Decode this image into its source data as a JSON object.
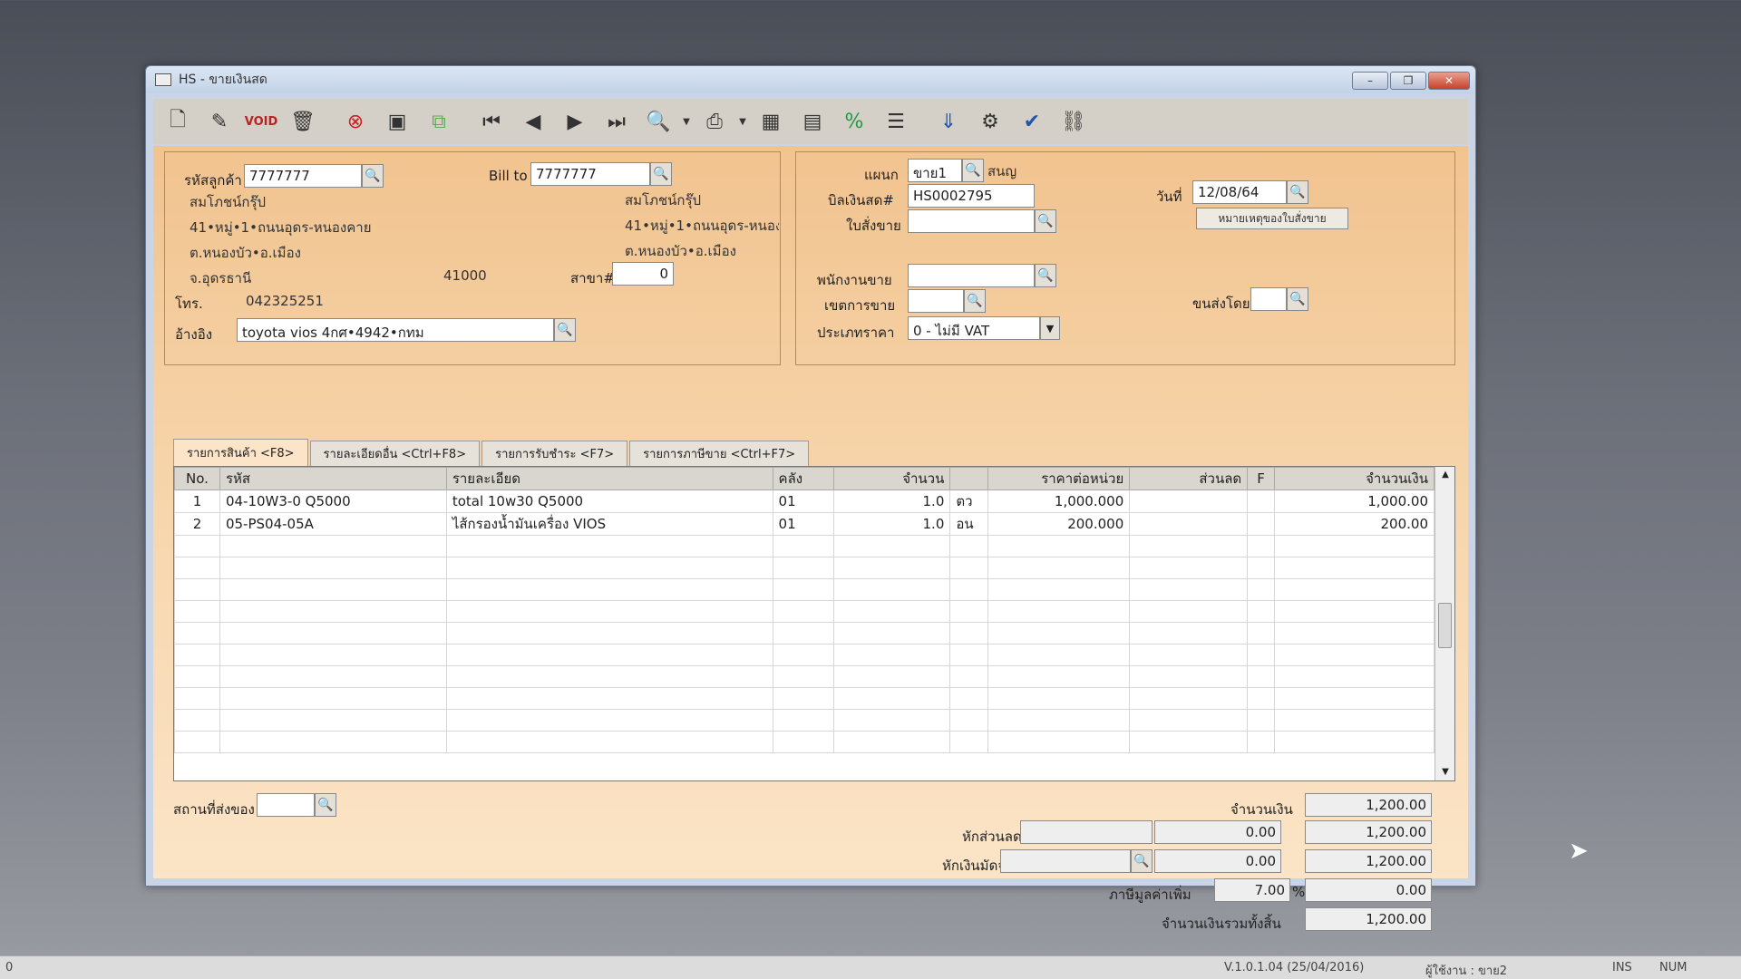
{
  "window": {
    "title": "HS - ขายเงินสด",
    "controls": [
      "–",
      "❐",
      "✕"
    ]
  },
  "toolbar": {
    "icons": [
      "new-doc-icon",
      "edit-icon",
      "void-icon",
      "delete-icon",
      "cancel-icon",
      "save-icon",
      "copy-icon",
      "first-icon",
      "prev-icon",
      "next-icon",
      "last-icon",
      "preview-icon",
      "print-icon",
      "calc-icon",
      "form-icon",
      "percent-icon",
      "report-icon",
      "approve-icon",
      "tools-icon",
      "ok-icon",
      "network-icon"
    ]
  },
  "customer": {
    "code_label": "รหัสลูกค้า",
    "code": "7777777",
    "name": "สมโภชน์กรุ๊ป",
    "address1": "41•หมู่•1•ถนนอุดร-หนองคาย",
    "address2": "ต.หนองบัว•อ.เมือง",
    "province": "จ.อุดรธานี",
    "postcode": "41000",
    "phone_label": "โทร.",
    "phone": "042325251",
    "ref_label": "อ้างอิง",
    "ref": "toyota vios 4กศ•4942•กทม"
  },
  "billto": {
    "label": "Bill to",
    "code": "7777777",
    "name": "สมโภชน์กรุ๊ป",
    "address1": "41•หมู่•1•ถนนอุดร-หนอง",
    "address2": "ต.หนองบัว•อ.เมือง",
    "branch_label": "สาขา#",
    "branch": "0"
  },
  "doc": {
    "dept_label": "แผนก",
    "dept": "ขาย1",
    "dept_name": "สนญ",
    "bill_label": "บิลเงินสด#",
    "bill": "HS0002795",
    "order_label": "ใบสั่งขาย",
    "order": "",
    "date_label": "วันที่",
    "date": "12/08/64",
    "note_button": "หมายเหตุของใบสั่งขาย",
    "salesman_label": "พนักงานขาย",
    "salesman": "",
    "area_label": "เขตการขาย",
    "area": "",
    "shipby_label": "ขนส่งโดย",
    "shipby": "",
    "pricetype_label": "ประเภทราคา",
    "pricetype": "0 - ไม่มี VAT"
  },
  "tabs": [
    "รายการสินค้า <F8>",
    "รายละเอียดอื่น <Ctrl+F8>",
    "รายการรับชำระ <F7>",
    "รายการภาษีขาย <Ctrl+F7>"
  ],
  "grid": {
    "headers": [
      "No.",
      "รหัส",
      "รายละเอียด",
      "คลัง",
      "จำนวน",
      "",
      "ราคาต่อหน่วย",
      "ส่วนลด",
      "F",
      "จำนวนเงิน"
    ],
    "rows": [
      [
        "1",
        "04-10W3-0 Q5000",
        "total 10w30 Q5000",
        "01",
        "1.0",
        "ตว",
        "1,000.000",
        "",
        "",
        "1,000.00"
      ],
      [
        "2",
        "05-PS04-05A",
        "ไส้กรองน้ำมันเครื่อง VIOS",
        "01",
        "1.0",
        "อน",
        "200.000",
        "",
        "",
        "200.00"
      ]
    ],
    "empty_rows": 10
  },
  "footer": {
    "shipto_label": "สถานที่ส่งของ",
    "shipto": "",
    "amount_label": "จำนวนเงิน",
    "amount": "1,200.00",
    "discount_label": "หักส่วนลด",
    "discount_text": "",
    "discount_value": "0.00",
    "after_discount": "1,200.00",
    "deposit_label": "หักเงินมัดจำ",
    "deposit_text": "",
    "deposit_value": "0.00",
    "after_deposit": "1,200.00",
    "vat_label": "ภาษีมูลค่าเพิ่ม",
    "vat_rate": "7.00",
    "vat_unit": "%",
    "vat_amount": "0.00",
    "total_label": "จำนวนเงินรวมทั้งสิ้น",
    "total": "1,200.00"
  },
  "statusbar": {
    "left": "0",
    "version": "V.1.0.1.04 (25/04/2016)",
    "user": "ผู้ใช้งาน : ขาย2",
    "ins": "INS",
    "num": "NUM"
  }
}
